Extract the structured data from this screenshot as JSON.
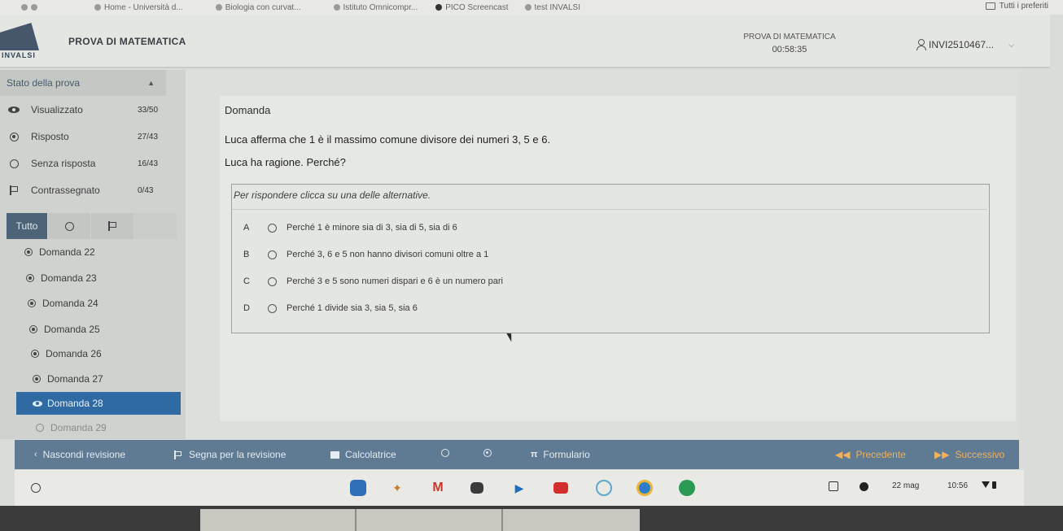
{
  "bookmarks": {
    "items": [
      "Home - Università d...",
      "Biologia con curvat...",
      "Istituto Omnicompr...",
      "PICO Screencast",
      "test INVALSI"
    ],
    "right_label": "Tutti i preferiti"
  },
  "header": {
    "logo_text": "INVALSI",
    "app_title": "PROVA DI MATEMATICA",
    "exam_title": "PROVA DI MATEMATICA",
    "timer": "00:58:35",
    "user_id": "INVI2510467..."
  },
  "sidebar": {
    "status_title": "Stato della prova",
    "stats": [
      {
        "label": "Visualizzato",
        "count": "33/50"
      },
      {
        "label": "Risposto",
        "count": "27/43"
      },
      {
        "label": "Senza risposta",
        "count": "16/43"
      },
      {
        "label": "Contrassegnato",
        "count": "0/43"
      }
    ],
    "filter_all": "Tutto",
    "questions": [
      "Domanda 22",
      "Domanda 23",
      "Domanda 24",
      "Domanda 25",
      "Domanda 26",
      "Domanda 27",
      "Domanda 28",
      "Domanda 29"
    ]
  },
  "question": {
    "label": "Domanda",
    "text1": "Luca afferma che 1 è il massimo comune divisore dei numeri 3, 5 e 6.",
    "text2": "Luca ha ragione. Perché?",
    "hint": "Per rispondere clicca su una delle alternative.",
    "options": [
      {
        "letter": "A",
        "text": "Perché 1 è minore sia di 3, sia di 5, sia di 6"
      },
      {
        "letter": "B",
        "text": "Perché 3, 6 e 5 non hanno divisori comuni oltre a 1"
      },
      {
        "letter": "C",
        "text": "Perché 3 e 5 sono numeri dispari e 6 è un numero pari"
      },
      {
        "letter": "D",
        "text": "Perché 1 divide sia 3, sia 5, sia 6"
      }
    ]
  },
  "toolbar": {
    "hide_review": "Nascondi revisione",
    "mark_review": "Segna per la revisione",
    "calculator": "Calcolatrice",
    "formulary": "Formulario",
    "previous": "Precedente",
    "next": "Successivo"
  },
  "shelf": {
    "date": "22 mag",
    "time": "10:56"
  }
}
